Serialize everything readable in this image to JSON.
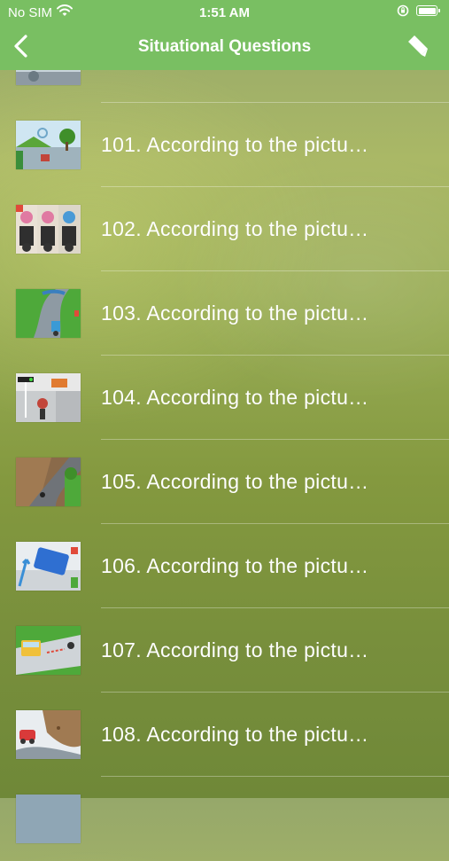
{
  "status_bar": {
    "carrier": "No SIM",
    "time": "1:51 AM"
  },
  "nav": {
    "title": "Situational Questions",
    "back_icon": "chevron-left-icon",
    "right_icon": "tag-icon"
  },
  "questions": [
    {
      "label": "101. According to the pictu…",
      "thumb": "traffic-scene"
    },
    {
      "label": "102. According to the pictu…",
      "thumb": "motorcycle-riders"
    },
    {
      "label": "103. According to the pictu…",
      "thumb": "curved-road"
    },
    {
      "label": "104. According to the pictu…",
      "thumb": "intersection"
    },
    {
      "label": "105. According to the pictu…",
      "thumb": "mountain-road"
    },
    {
      "label": "106. According to the pictu…",
      "thumb": "bus-turning"
    },
    {
      "label": "107. According to the pictu…",
      "thumb": "car-crossing"
    },
    {
      "label": "108. According to the pictu…",
      "thumb": "rockfall-road"
    }
  ],
  "colors": {
    "header": "#79bf62",
    "row_text": "#ffffff"
  }
}
